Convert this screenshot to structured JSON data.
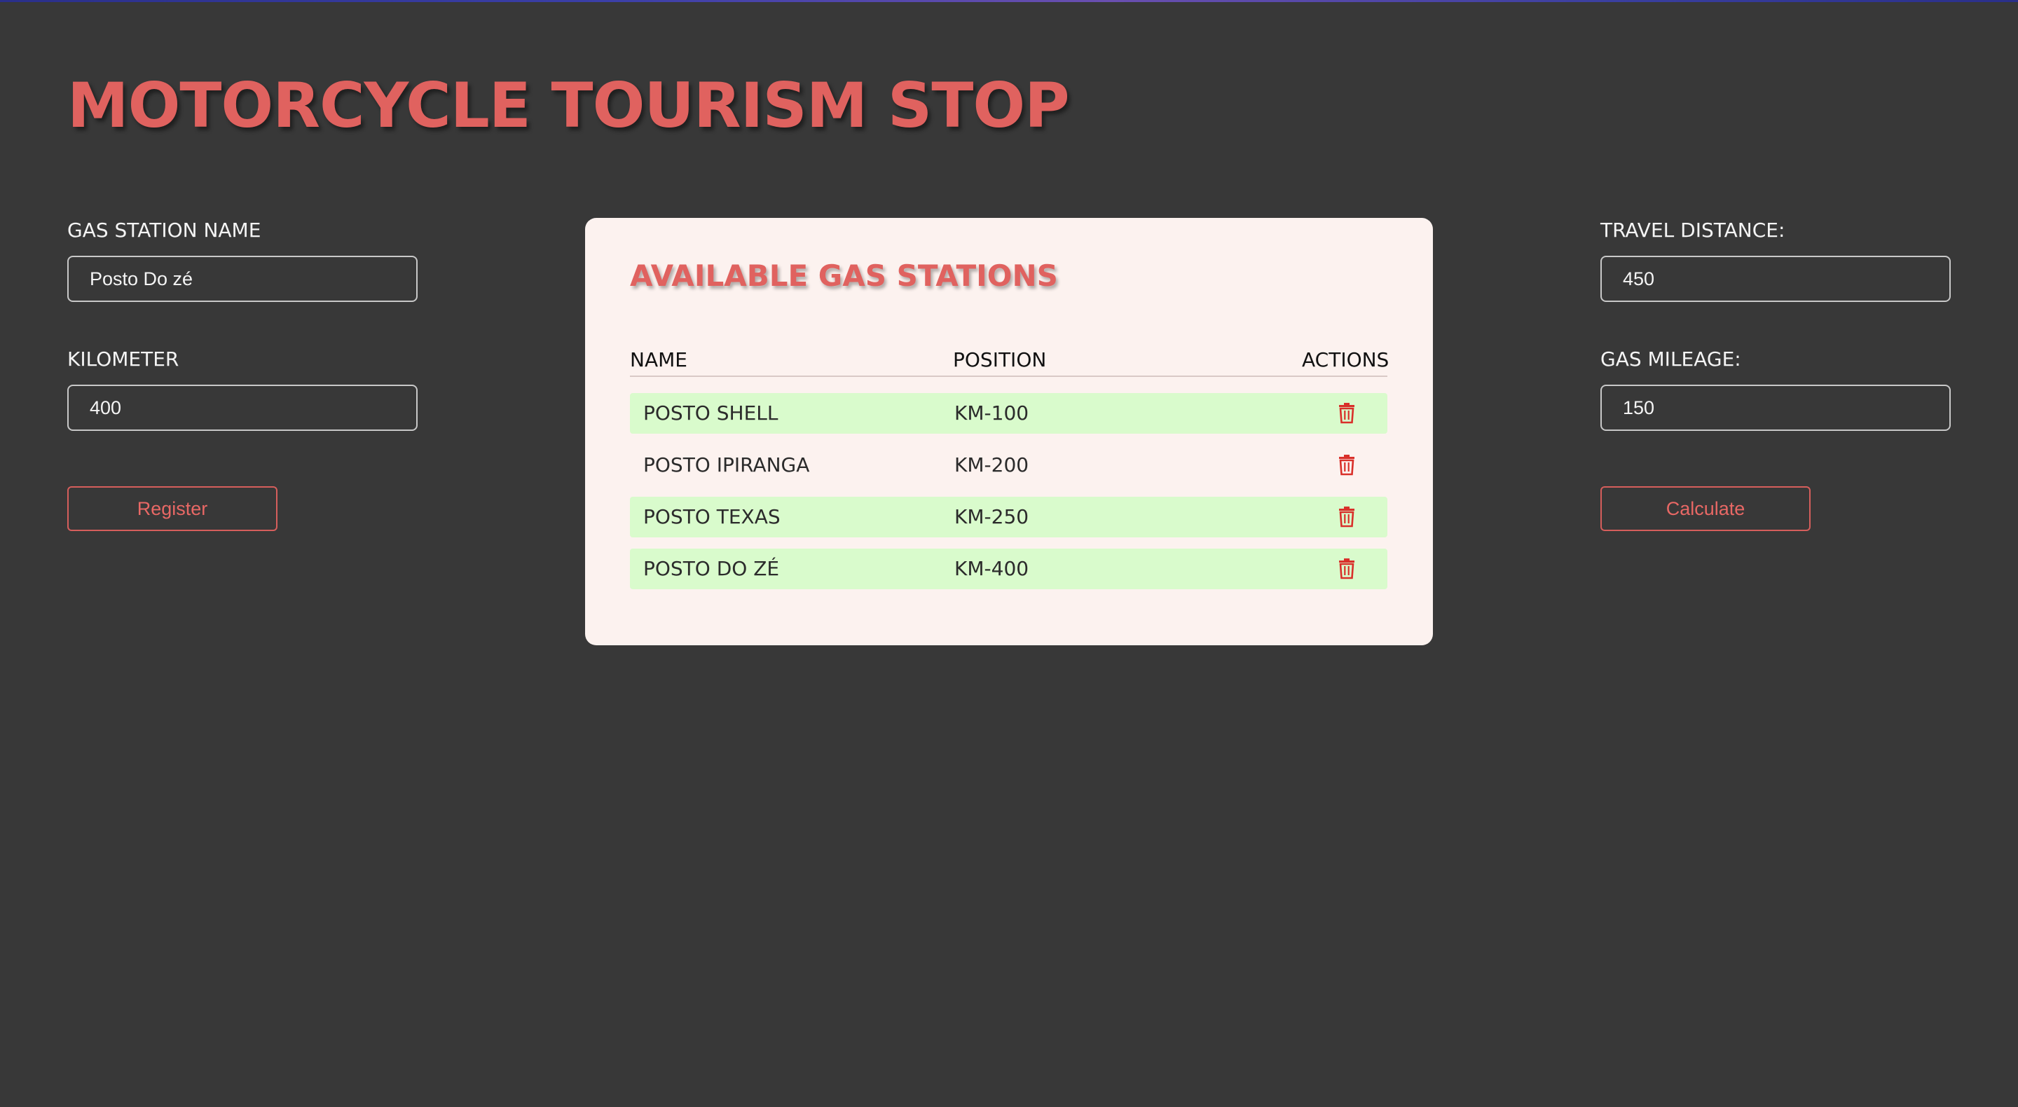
{
  "page": {
    "title": "MOTORCYCLE TOURISM STOP"
  },
  "left_form": {
    "station_name_label": "GAS STATION NAME",
    "station_name_value": "Posto Do zé",
    "kilometer_label": "KILOMETER",
    "kilometer_value": "400",
    "register_label": "Register"
  },
  "stations_card": {
    "title": "AVAILABLE GAS STATIONS",
    "columns": [
      "NAME",
      "POSITION",
      "ACTIONS"
    ],
    "rows": [
      {
        "name": "POSTO SHELL",
        "position": "KM-100",
        "highlighted": true
      },
      {
        "name": "POSTO IPIRANGA",
        "position": "KM-200",
        "highlighted": false
      },
      {
        "name": "POSTO TEXAS",
        "position": "KM-250",
        "highlighted": true
      },
      {
        "name": "POSTO DO ZÉ",
        "position": "KM-400",
        "highlighted": true
      }
    ],
    "action_icon": "trash-icon"
  },
  "right_form": {
    "travel_distance_label": "TRAVEL DISTANCE:",
    "travel_distance_value": "450",
    "gas_mileage_label": "GAS MILEAGE:",
    "gas_mileage_value": "150",
    "calculate_label": "Calculate"
  },
  "colors": {
    "background": "#383838",
    "accent": "#e0625f",
    "card_background": "#fcf2ef",
    "row_highlight": "#d9fbcc"
  }
}
